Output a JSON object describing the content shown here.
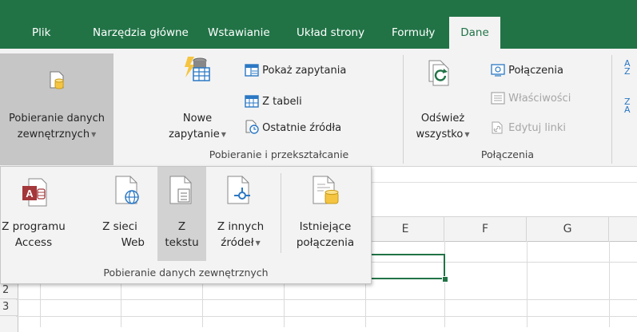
{
  "ribbon_tabs": [
    "Plik",
    "Narzędzia główne",
    "Wstawianie",
    "Układ strony",
    "Formuły",
    "Dane"
  ],
  "active_tab": "Dane",
  "ribbon": {
    "get_external": {
      "line1": "Pobieranie danych",
      "line2": "zewnętrznych"
    },
    "new_query": {
      "line1": "Nowe",
      "line2": "zapytanie"
    },
    "show_queries": "Pokaż zapytania",
    "from_table": "Z tabeli",
    "recent_sources": "Ostatnie źródła",
    "group_transform": "Pobieranie i przekształcanie",
    "refresh_all": {
      "line1": "Odśwież",
      "line2": "wszystko"
    },
    "connections": "Połączenia",
    "properties": "Właściwości",
    "edit_links": "Edytuj linki",
    "group_connections": "Połączenia",
    "sort_az": {
      "top": "A",
      "bottom": "Z"
    },
    "sort_za": {
      "top": "Z",
      "bottom": "A"
    }
  },
  "dropdown": {
    "items": [
      {
        "line1": "Z programu",
        "line2": "Access"
      },
      {
        "line1": "Z sieci",
        "line2": "Web"
      },
      {
        "line1": "Z",
        "line2": "tekstu"
      },
      {
        "line1": "Z innych",
        "line2": "źródeł"
      },
      {
        "line1": "Istniejące",
        "line2": "połączenia"
      }
    ],
    "group_label": "Pobieranie danych zewnętrznych"
  },
  "grid": {
    "columns": [
      "E",
      "F",
      "G"
    ],
    "rows": [
      "2",
      "3"
    ]
  },
  "colors": {
    "ribbon_green": "#217346",
    "access_red": "#a4373a",
    "selection_green": "#217346",
    "icon_yellow": "#f5c542",
    "icon_blue": "#2b78c4"
  }
}
